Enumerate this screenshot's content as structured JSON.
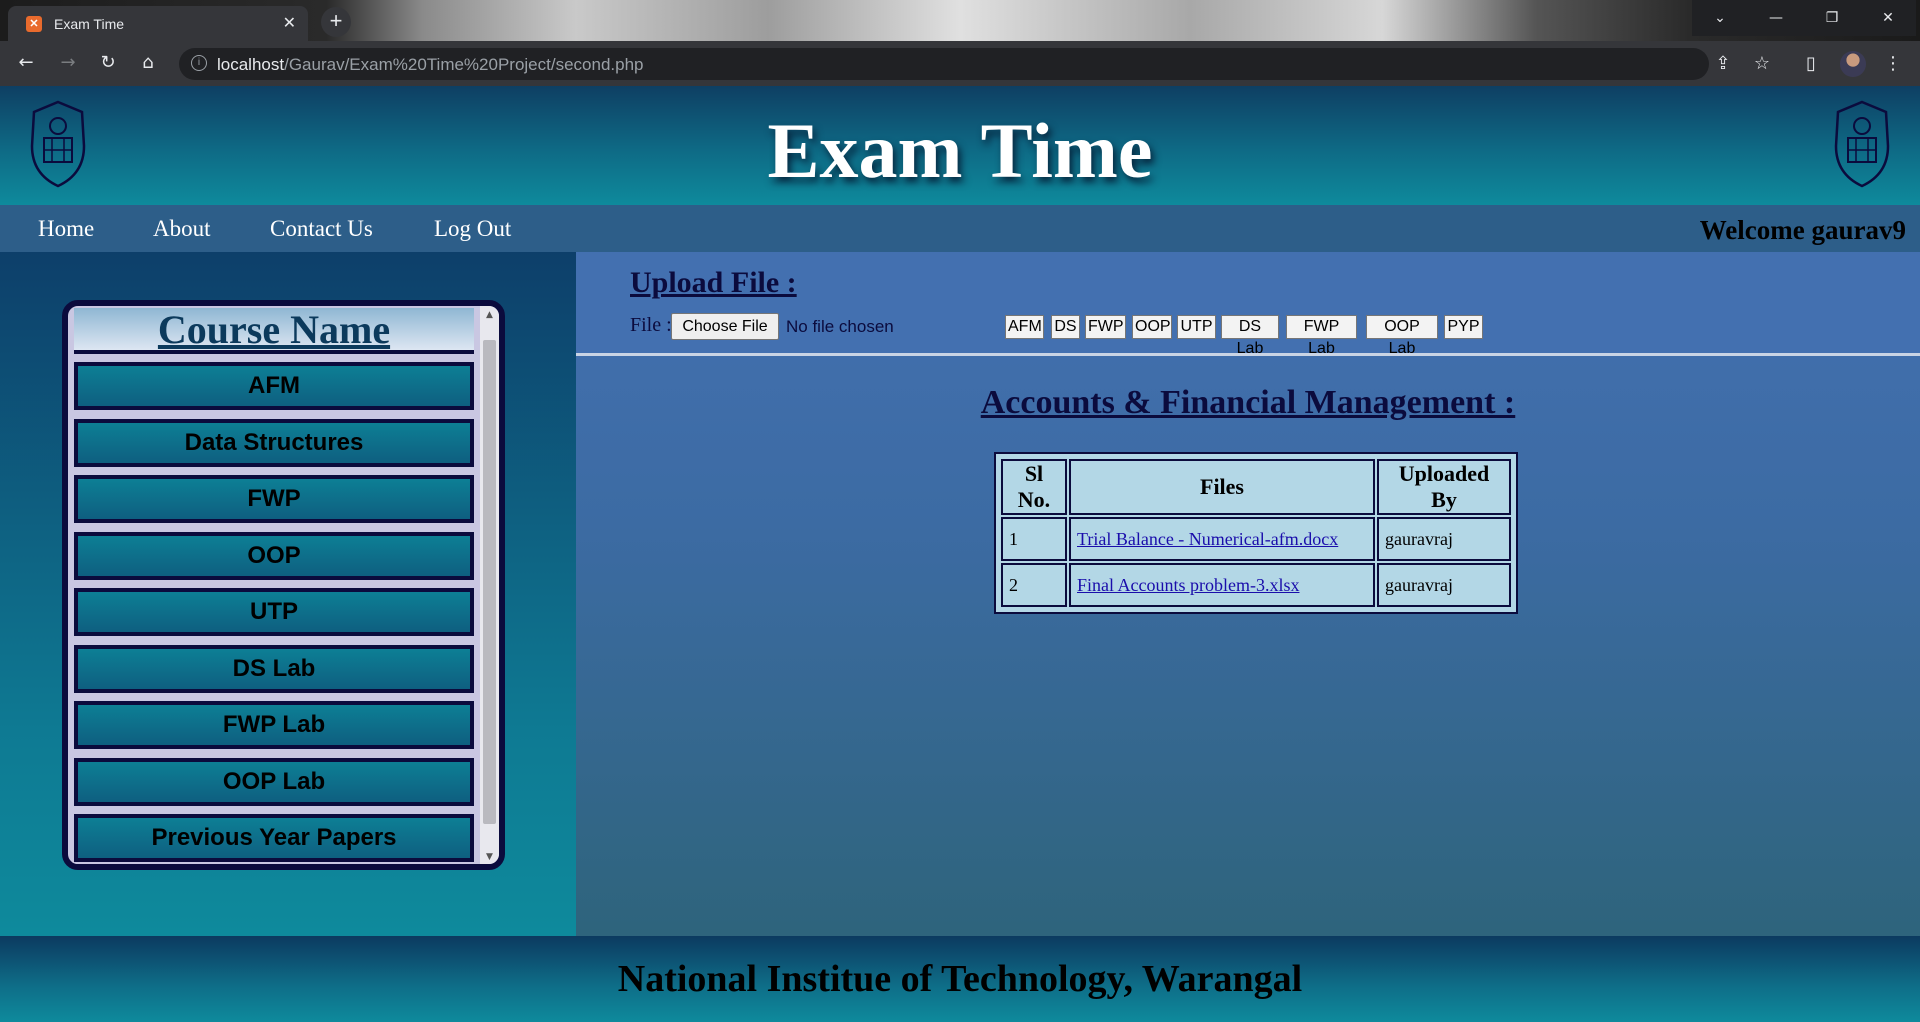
{
  "browser": {
    "tab_title": "Exam Time",
    "url_host": "localhost",
    "url_path": "/Gaurav/Exam%20Time%20Project/second.php"
  },
  "header": {
    "title": "Exam Time"
  },
  "nav": {
    "items": [
      "Home",
      "About",
      "Contact Us",
      "Log Out"
    ],
    "welcome": "Welcome gaurav9"
  },
  "sidebar": {
    "heading": "Course Name",
    "courses": [
      "AFM",
      "Data Structures",
      "FWP",
      "OOP",
      "UTP",
      "DS Lab",
      "FWP Lab",
      "OOP Lab",
      "Previous Year Papers"
    ]
  },
  "upload": {
    "title": "Upload File :",
    "file_label": "File :",
    "choose_button": "Choose File",
    "no_file_text": "No file chosen",
    "subject_buttons": [
      "AFM",
      "DS",
      "FWP",
      "OOP",
      "UTP",
      "DS Lab",
      "FWP Lab",
      "OOP Lab",
      "PYP"
    ]
  },
  "content": {
    "section_title": "Accounts & Financial Management :",
    "table": {
      "headers": [
        "Sl No.",
        "Files",
        "Uploaded By"
      ],
      "rows": [
        [
          "1",
          "Trial Balance - Numerical-afm.docx",
          "gauravraj"
        ],
        [
          "2",
          "Final Accounts problem-3.xlsx",
          "gauravraj"
        ]
      ]
    }
  },
  "footer": {
    "text": "National Institue of Technology, Warangal"
  },
  "colors": {
    "header_teal": "#0e6b86",
    "nav_blue": "#2d5e89",
    "main_blue": "#4370b0",
    "dark_navy": "#0b0b3d",
    "table_bg": "#b3d7e6"
  }
}
